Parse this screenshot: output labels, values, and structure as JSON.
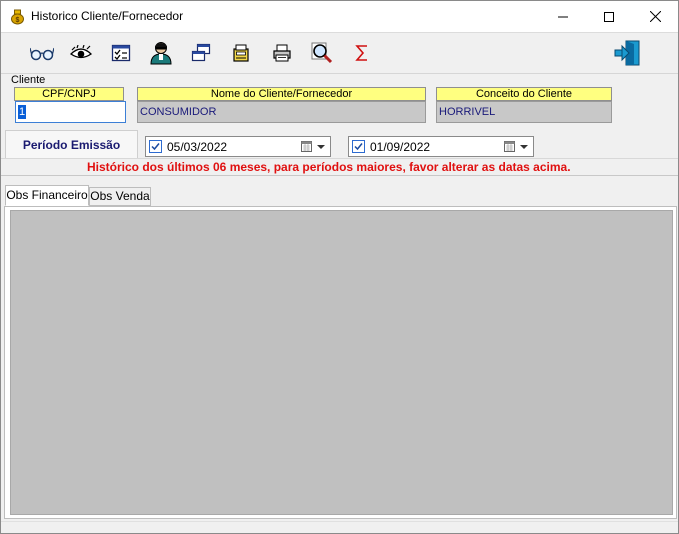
{
  "window": {
    "title": "Historico Cliente/Fornecedor",
    "app_icon": "money-bag-icon"
  },
  "toolbar": {
    "buttons": [
      {
        "name": "glasses-icon"
      },
      {
        "name": "eye-icon"
      },
      {
        "name": "checklist-icon"
      },
      {
        "name": "user-icon"
      },
      {
        "name": "windows-icon"
      },
      {
        "name": "register-icon"
      },
      {
        "name": "printer-icon"
      },
      {
        "name": "search-icon"
      },
      {
        "name": "sigma-icon"
      },
      {
        "name": "exit-icon"
      }
    ]
  },
  "cliente": {
    "group_label": "Cliente",
    "cpf_label": "CPF/CNPJ",
    "cpf_value": "1",
    "nome_label": "Nome do Cliente/Fornecedor",
    "nome_value": "CONSUMIDOR",
    "conceito_label": "Conceito do Cliente",
    "conceito_value": "HORRIVEL"
  },
  "periodo": {
    "label": "Período Emissão",
    "start_date": "05/03/2022",
    "end_date": "01/09/2022",
    "note": "Histórico  dos últimos 06 meses, para períodos maiores, favor alterar as datas acima."
  },
  "tabs": [
    {
      "label": "Obs Financeiro",
      "active": true
    },
    {
      "label": "Obs Venda",
      "active": false
    }
  ],
  "colors": {
    "header_yellow": "#ffff80",
    "note_red": "#e01010",
    "field_text": "#1a1a7a"
  }
}
